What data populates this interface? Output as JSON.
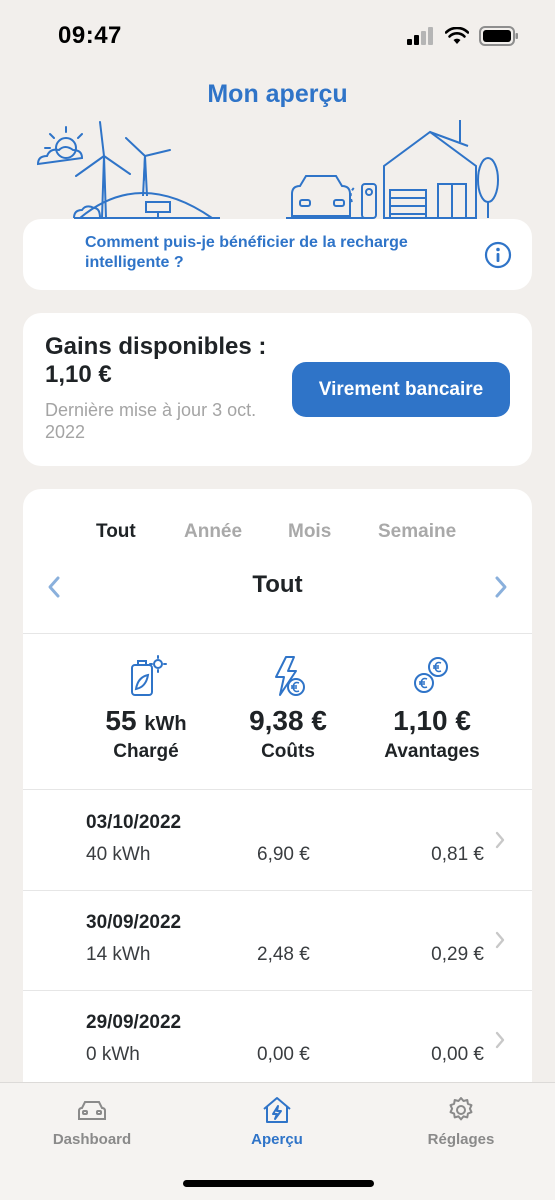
{
  "status_bar": {
    "time": "09:47"
  },
  "header": {
    "title": "Mon aperçu"
  },
  "info_card": {
    "text": "Comment puis-je bénéficier de la recharge intelligente ?"
  },
  "gains": {
    "title": "Gains disponibles :",
    "amount": "1,10 €",
    "updated": "Dernière mise à jour 3 oct. 2022",
    "button_label": "Virement bancaire"
  },
  "period": {
    "tabs": [
      "Tout",
      "Année",
      "Mois",
      "Semaine"
    ],
    "active_tab": "Tout",
    "current_label": "Tout"
  },
  "summary": {
    "charged_value": "55",
    "charged_unit": "kWh",
    "charged_label": "Chargé",
    "costs_value": "9,38 €",
    "costs_label": "Coûts",
    "advantages_value": "1,10 €",
    "advantages_label": "Avantages"
  },
  "sessions": [
    {
      "date": "03/10/2022",
      "kwh": "40 kWh",
      "cost": "6,90 €",
      "advantage": "0,81 €"
    },
    {
      "date": "30/09/2022",
      "kwh": "14 kWh",
      "cost": "2,48 €",
      "advantage": "0,29 €"
    },
    {
      "date": "29/09/2022",
      "kwh": "0 kWh",
      "cost": "0,00 €",
      "advantage": "0,00 €"
    }
  ],
  "bottom_nav": [
    {
      "label": "Dashboard",
      "icon": "car-icon"
    },
    {
      "label": "Aperçu",
      "icon": "house-bolt-icon"
    },
    {
      "label": "Réglages",
      "icon": "gear-icon"
    }
  ],
  "colors": {
    "accent": "#2f74c8",
    "background": "#f2efec",
    "card": "#ffffff",
    "muted_text": "#a4a4a4",
    "inactive_tab": "#a9a9a9"
  }
}
